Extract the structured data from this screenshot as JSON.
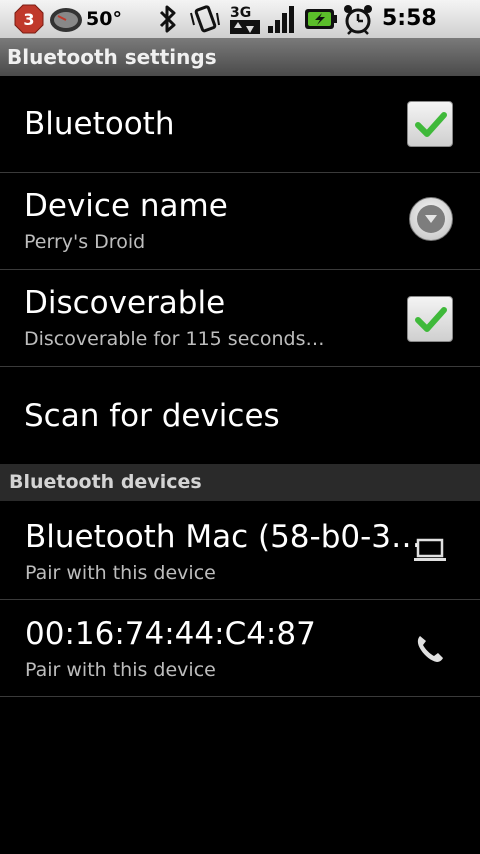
{
  "status_bar": {
    "notification_count": "3",
    "temperature": "50°",
    "time": "5:58 PM",
    "network_label": "3G",
    "icons": [
      "notification-badge-icon",
      "speedometer-icon",
      "bluetooth-icon",
      "vibrate-icon",
      "3g-data-icon",
      "signal-strength-icon",
      "battery-charging-icon",
      "alarm-clock-icon"
    ]
  },
  "title_bar": {
    "title": "Bluetooth settings"
  },
  "settings": {
    "bluetooth": {
      "label": "Bluetooth",
      "checked": true
    },
    "device_name": {
      "label": "Device name",
      "summary": "Perry's Droid"
    },
    "discoverable": {
      "label": "Discoverable",
      "summary": "Discoverable for 115 seconds…",
      "checked": true
    },
    "scan": {
      "label": "Scan for devices"
    }
  },
  "devices_section": {
    "header": "Bluetooth devices",
    "devices": [
      {
        "name": "Bluetooth Mac (58-b0-3…",
        "summary": "Pair with this device",
        "icon": "laptop-icon"
      },
      {
        "name": "00:16:74:44:C4:87",
        "summary": "Pair with this device",
        "icon": "phone-icon"
      }
    ]
  },
  "colors": {
    "check_green": "#3fb93a",
    "divider": "#3a3a3a",
    "summary_text": "#bdbdbd"
  }
}
